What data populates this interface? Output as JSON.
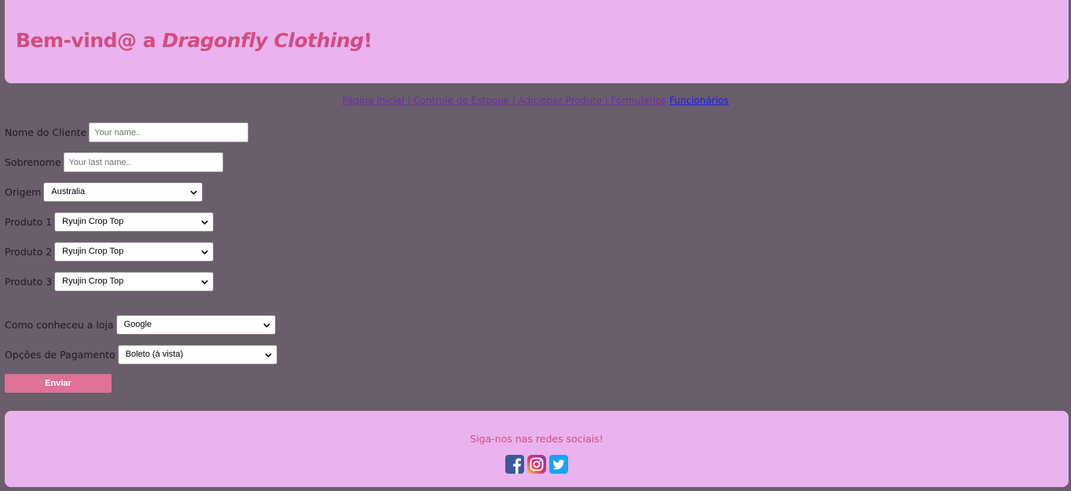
{
  "header": {
    "title_prefix": "Bem-vind@ a ",
    "title_brand": "Dragonfly Clothing",
    "title_suffix": "!"
  },
  "nav": {
    "items": [
      {
        "label": "Página Inicial "
      },
      {
        "label": " Controle de Estoque "
      },
      {
        "label": " Adicionar Produto "
      },
      {
        "label": " Formularios"
      },
      {
        "label": "Funcionários"
      }
    ]
  },
  "form": {
    "first_name": {
      "label": "Nome do Cliente",
      "placeholder": "Your name.."
    },
    "last_name": {
      "label": "Sobrenome",
      "placeholder": "Your last name.."
    },
    "origin": {
      "label": "Origem",
      "value": "Australia"
    },
    "product1": {
      "label": "Produto 1",
      "value": "Ryujin Crop Top"
    },
    "product2": {
      "label": "Produto 2",
      "value": "Ryujin Crop Top"
    },
    "product3": {
      "label": "Produto 3",
      "value": "Ryujin Crop Top"
    },
    "source": {
      "label": "Como conheceu a loja",
      "value": "Google"
    },
    "payment": {
      "label": "Opções de Pagamento",
      "value": "Boleto (à vista)"
    },
    "submit_label": "Enviar"
  },
  "footer": {
    "follow_text": "Siga-nos nas redes sociais!",
    "social_icons": [
      "facebook-icon",
      "instagram-icon",
      "twitter-icon"
    ]
  },
  "colors": {
    "background": "#6a5d6c",
    "panel": "#eab2ef",
    "accent": "#d14d7e",
    "button": "#e07094"
  }
}
